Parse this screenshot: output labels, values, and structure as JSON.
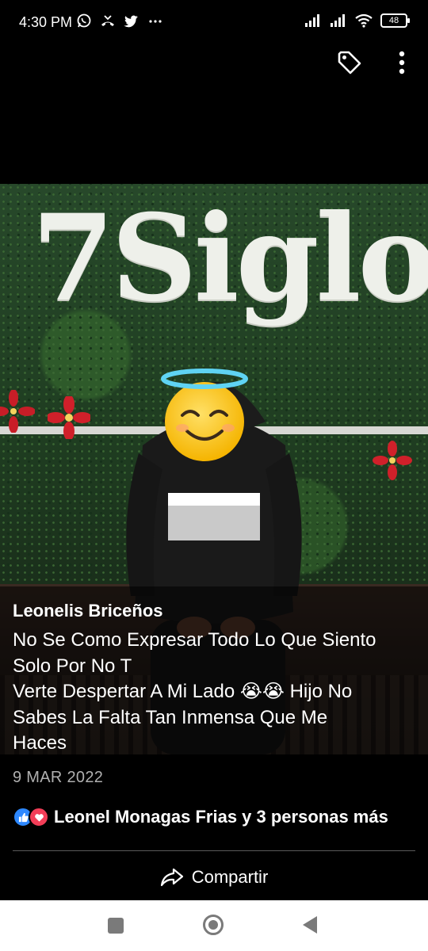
{
  "status_bar": {
    "time": "4:30 PM",
    "battery": "48",
    "left_icons": [
      "whatsapp-icon",
      "missed-call-icon",
      "twitter-icon",
      "more-notifications-icon"
    ],
    "right_icons": [
      "signal-icon",
      "signal-icon",
      "wifi-icon",
      "battery-icon"
    ]
  },
  "top_actions": {
    "icons": [
      "tag-icon",
      "more-vertical-icon"
    ]
  },
  "photo": {
    "sign_text": "7Siglo",
    "colors": {
      "foliage": "#27482a",
      "flowers": "#d0202a",
      "sign": "#eef0ea"
    }
  },
  "post": {
    "author": "Leonelis Briceños",
    "message_lines": [
      "No Se Como Expresar Todo Lo Que Siento",
      "Solo Por No T",
      "Verte Despertar A Mi Lado 😭😭 Hijo No",
      "Sabes La Falta Tan Inmensa Que Me",
      "Haces"
    ],
    "date": "9 MAR 2022",
    "reactions": {
      "icons": [
        "like-icon",
        "love-icon"
      ],
      "names": "Leonel Monagas Frias y 3 personas más"
    },
    "share_label": "Compartir"
  },
  "nav_bar": {
    "icons": [
      "recent-apps-icon",
      "home-icon",
      "back-icon"
    ]
  },
  "colors": {
    "background": "#000000",
    "like": "#2d88ff",
    "love": "#f33e58",
    "date": "#b0b0b0",
    "nav_icon": "#7a7a7a"
  }
}
